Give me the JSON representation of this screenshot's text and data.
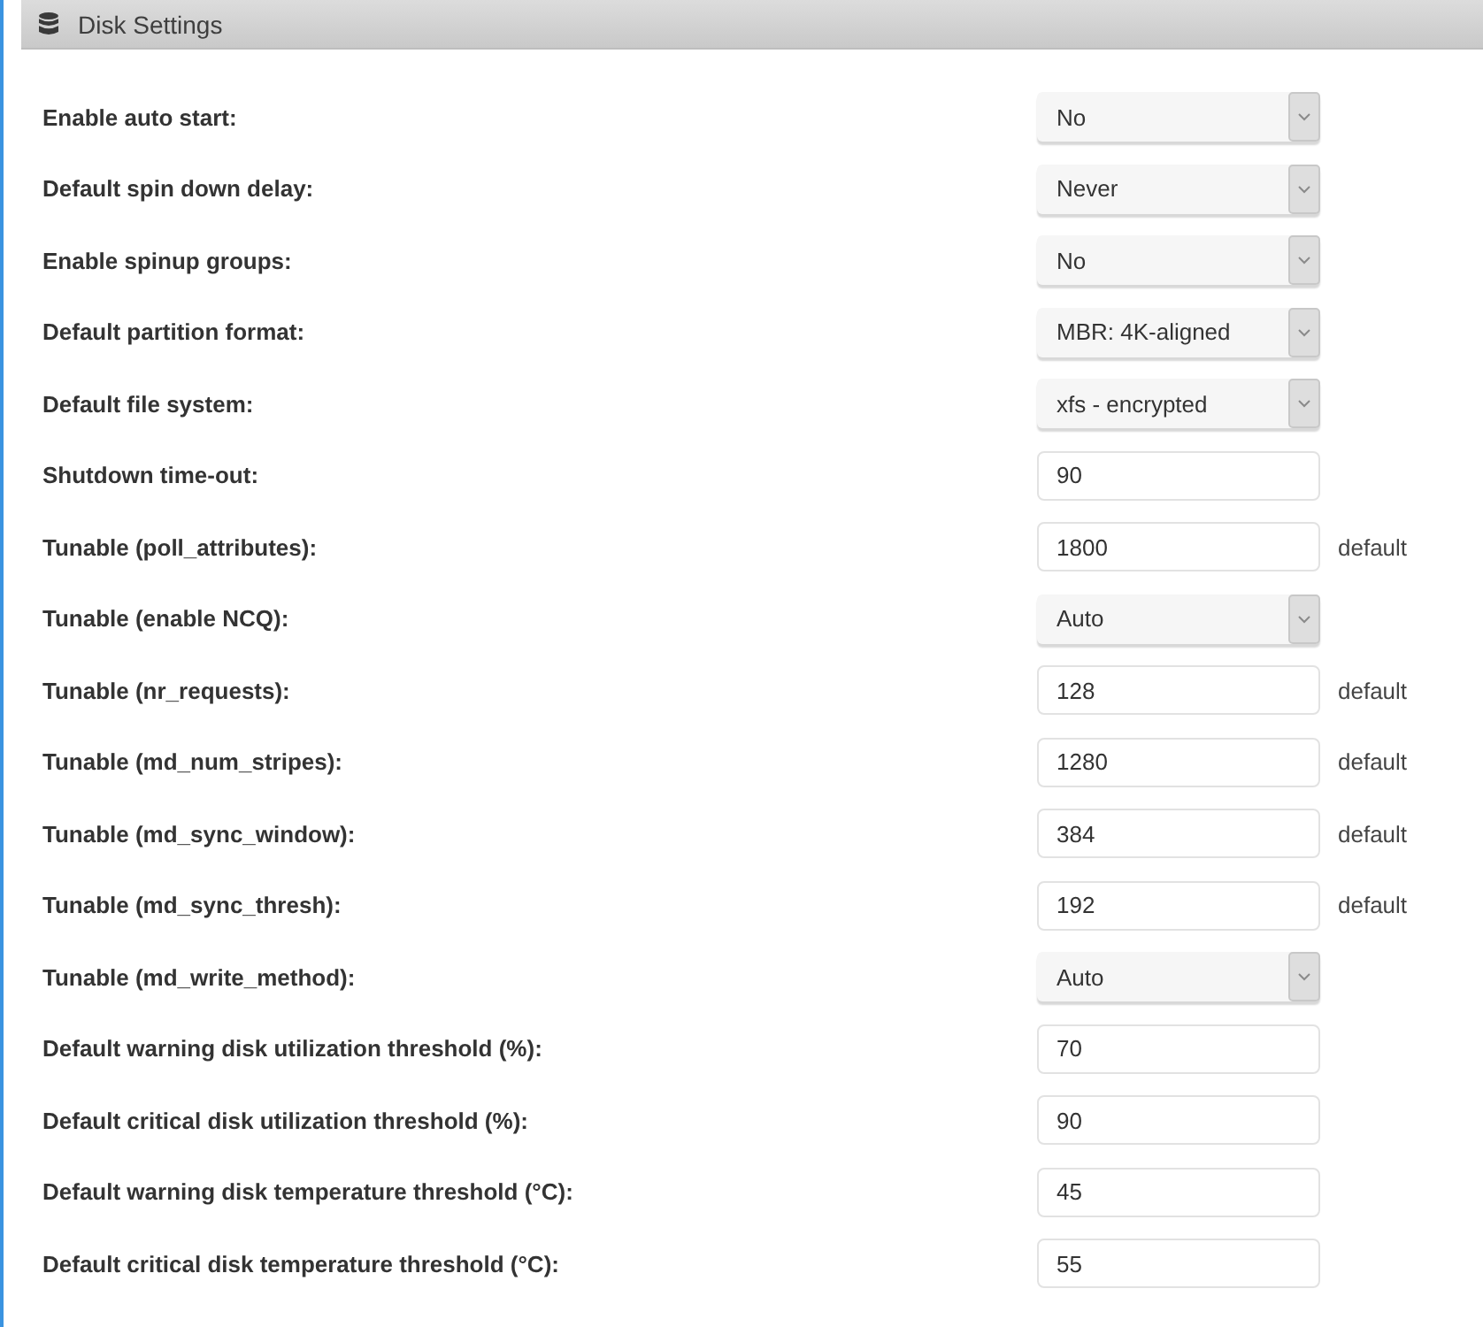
{
  "panel": {
    "title": "Disk Settings"
  },
  "settings": [
    {
      "label": "Enable auto start:",
      "kind": "select",
      "value": "No"
    },
    {
      "label": "Default spin down delay:",
      "kind": "select",
      "value": "Never"
    },
    {
      "label": "Enable spinup groups:",
      "kind": "select",
      "value": "No"
    },
    {
      "label": "Default partition format:",
      "kind": "select",
      "value": "MBR: 4K-aligned"
    },
    {
      "label": "Default file system:",
      "kind": "select",
      "value": "xfs - encrypted"
    },
    {
      "label": "Shutdown time-out:",
      "kind": "input",
      "value": "90"
    },
    {
      "label": "Tunable (poll_attributes):",
      "kind": "input",
      "value": "1800",
      "note": "default"
    },
    {
      "label": "Tunable (enable NCQ):",
      "kind": "select",
      "value": "Auto"
    },
    {
      "label": "Tunable (nr_requests):",
      "kind": "input",
      "value": "128",
      "note": "default"
    },
    {
      "label": "Tunable (md_num_stripes):",
      "kind": "input",
      "value": "1280",
      "note": "default"
    },
    {
      "label": "Tunable (md_sync_window):",
      "kind": "input",
      "value": "384",
      "note": "default"
    },
    {
      "label": "Tunable (md_sync_thresh):",
      "kind": "input",
      "value": "192",
      "note": "default"
    },
    {
      "label": "Tunable (md_write_method):",
      "kind": "select",
      "value": "Auto"
    },
    {
      "label": "Default warning disk utilization threshold (%):",
      "kind": "input",
      "value": "70"
    },
    {
      "label": "Default critical disk utilization threshold (%):",
      "kind": "input",
      "value": "90"
    },
    {
      "label": "Default warning disk temperature threshold (°C):",
      "kind": "input",
      "value": "45"
    },
    {
      "label": "Default critical disk temperature threshold (°C):",
      "kind": "input",
      "value": "55"
    }
  ]
}
